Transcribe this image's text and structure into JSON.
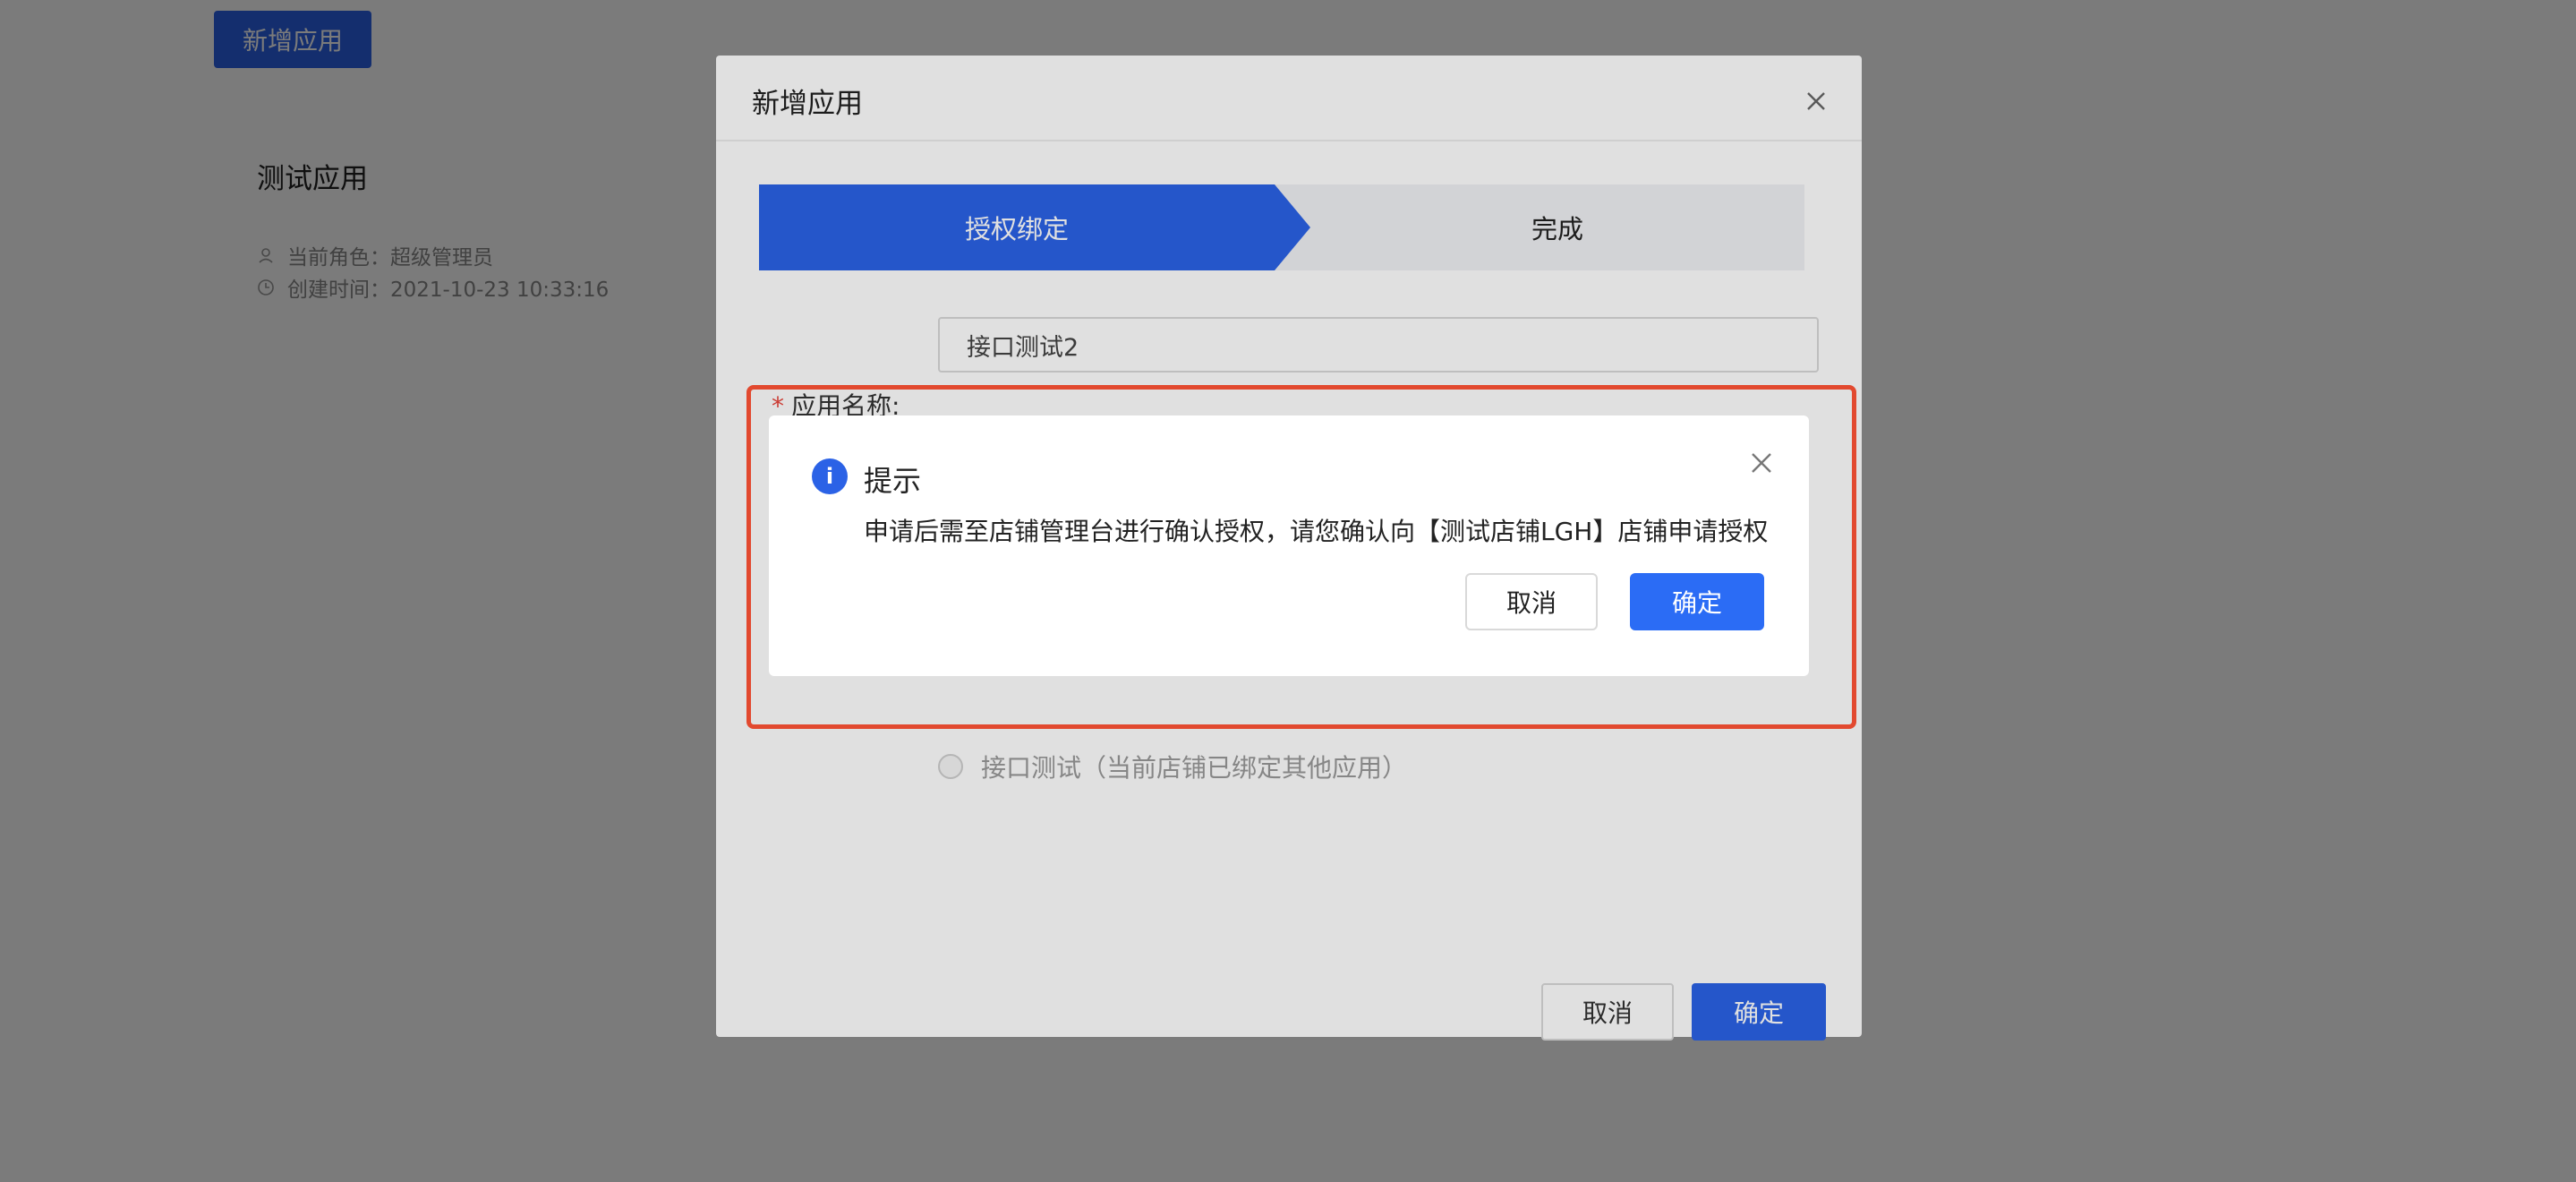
{
  "page": {
    "add_button_label": "新增应用",
    "app_card": {
      "title": "测试应用",
      "role_label": "当前角色：超级管理员",
      "created_label": "创建时间：2021-10-23 10:33:16"
    }
  },
  "dialog": {
    "title": "新增应用",
    "steps": [
      {
        "label": "授权绑定",
        "active": true
      },
      {
        "label": "完成",
        "active": false
      }
    ],
    "form": {
      "required_mark": "*",
      "app_name_label": "应用名称:",
      "app_name_value": "接口测试2",
      "radio_option_label": "接口测试（当前店铺已绑定其他应用）"
    },
    "cancel_label": "取消",
    "ok_label": "确定"
  },
  "confirm": {
    "icon": "info-icon",
    "icon_glyph": "i",
    "title": "提示",
    "message": "申请后需至店铺管理台进行确认授权，请您确认向【测试店铺LGH】店铺申请授权",
    "cancel_label": "取消",
    "ok_label": "确定"
  },
  "colors": {
    "primary": "#2b62e6",
    "confirm_primary": "#2b6cf5",
    "highlight": "#e2492f",
    "required": "#e8453c"
  }
}
